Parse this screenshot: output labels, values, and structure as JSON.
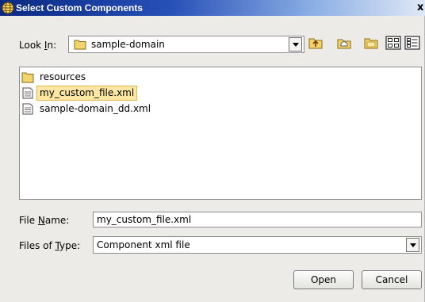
{
  "window": {
    "title": "Select Custom Components",
    "close_glyph": "x"
  },
  "lookin": {
    "label_pre": "Look ",
    "label_mn": "I",
    "label_post": "n:",
    "value": "sample-domain"
  },
  "toolbar": {
    "buttons": [
      {
        "icon": "up-one-level-icon"
      },
      {
        "icon": "home-icon"
      },
      {
        "icon": "new-folder-icon"
      },
      {
        "icon": "list-view-icon"
      },
      {
        "icon": "details-view-icon"
      }
    ]
  },
  "files": [
    {
      "name": "resources",
      "type": "folder",
      "selected": false
    },
    {
      "name": "my_custom_file.xml",
      "type": "file",
      "selected": true
    },
    {
      "name": "sample-domain_dd.xml",
      "type": "file",
      "selected": false
    }
  ],
  "filename": {
    "label_pre": "File ",
    "label_mn": "N",
    "label_post": "ame:",
    "value": "my_custom_file.xml"
  },
  "filetype": {
    "label_pre": "Files of ",
    "label_mn": "T",
    "label_post": "ype:",
    "value": "Component xml file"
  },
  "actions": {
    "open": "Open",
    "cancel": "Cancel"
  },
  "colors": {
    "title_start": "#0a2a82",
    "selection": "#fde7a3",
    "folder": "#f3d36b"
  }
}
